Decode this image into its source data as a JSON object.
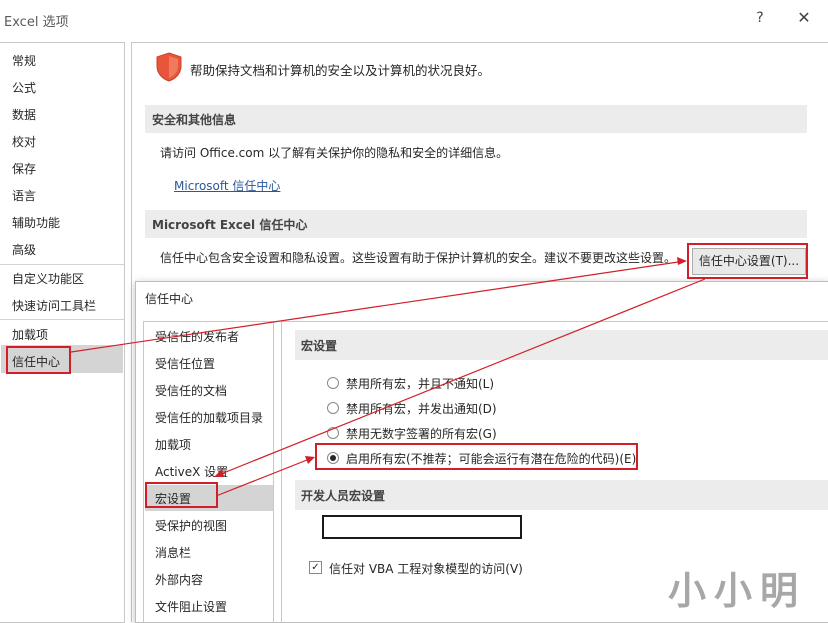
{
  "window": {
    "title": "Excel 选项",
    "help_label": "?",
    "close_label": "✕"
  },
  "nav": {
    "items": [
      "常规",
      "公式",
      "数据",
      "校对",
      "保存",
      "语言",
      "辅助功能",
      "高级",
      "自定义功能区",
      "快速访问工具栏",
      "加载项",
      "信任中心"
    ],
    "selected": "信任中心"
  },
  "main": {
    "intro": "帮助保持文档和计算机的安全以及计算机的状况良好。",
    "security_section": {
      "header": "安全和其他信息",
      "text": "请访问 Office.com  以了解有关保护你的隐私和安全的详细信息。",
      "link": "Microsoft 信任中心"
    },
    "trust_center_section": {
      "header": "Microsoft Excel 信任中心",
      "text": "信任中心包含安全设置和隐私设置。这些设置有助于保护计算机的安全。建议不要更改这些设置。",
      "button": "信任中心设置(T)..."
    }
  },
  "trust_center_dialog": {
    "title": "信任中心",
    "nav_items": [
      "受信任的发布者",
      "受信任位置",
      "受信任的文档",
      "受信任的加载项目录",
      "加载项",
      "ActiveX 设置",
      "宏设置",
      "受保护的视图",
      "消息栏",
      "外部内容",
      "文件阻止设置"
    ],
    "selected": "宏设置",
    "macro_section": {
      "header": "宏设置",
      "options": [
        {
          "label": "禁用所有宏，并且不通知(L)",
          "checked": false
        },
        {
          "label": "禁用所有宏，并发出通知(D)",
          "checked": false
        },
        {
          "label": "禁用无数字签署的所有宏(G)",
          "checked": false
        },
        {
          "label": "启用所有宏(不推荐；可能会运行有潜在危险的代码)(E)",
          "checked": true
        }
      ]
    },
    "developer_section": {
      "header": "开发人员宏设置",
      "checkbox_label": "信任对 VBA 工程对象模型的访问(V)",
      "checkbox_checked": true,
      "checkbox_mark": "✓"
    }
  },
  "watermark": "小小明",
  "colors": {
    "highlight": "#d11f2a",
    "link": "#2b579a",
    "shield": "#e8553a",
    "selected_bg": "#d4d4d4"
  }
}
